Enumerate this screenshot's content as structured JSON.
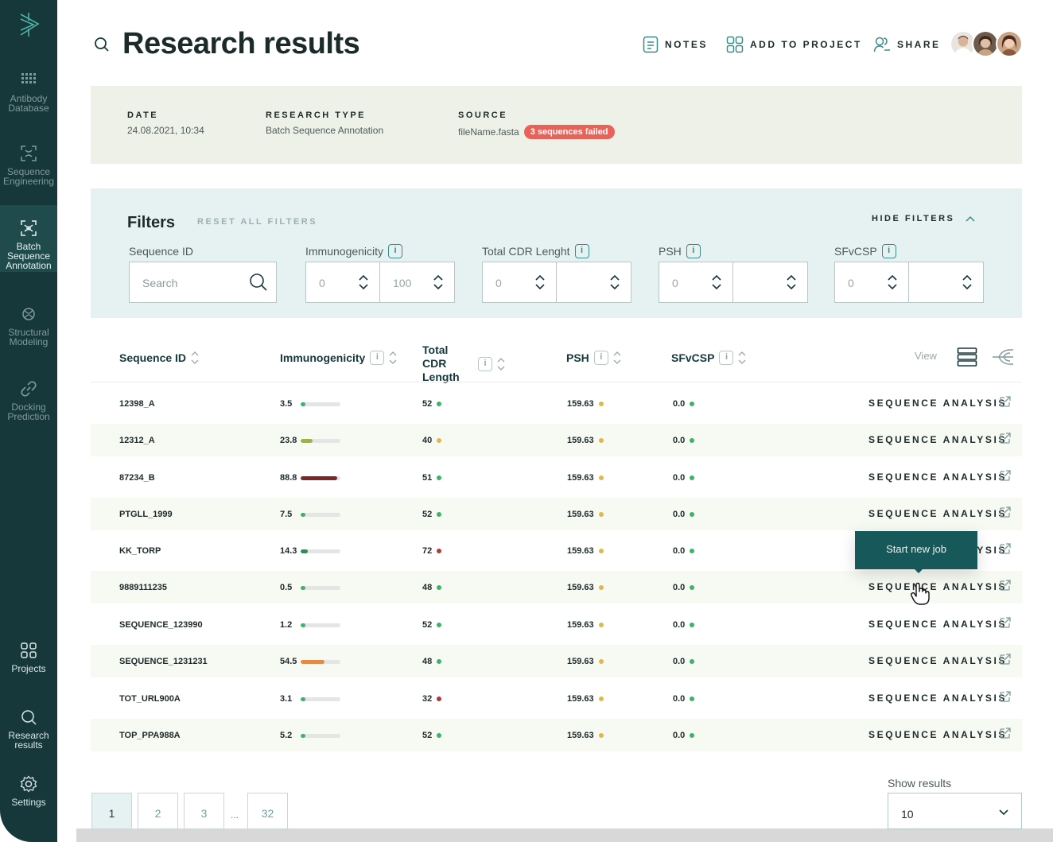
{
  "sidebar": {
    "items": [
      {
        "label": "Antibody\nDatabase",
        "icon": "grid-dots-icon"
      },
      {
        "label": "Sequence\nEngineering",
        "icon": "dna-frame-icon"
      },
      {
        "label": "Batch\nSequence\nAnnotation",
        "icon": "batch-dna-icon"
      },
      {
        "label": "Structural\nModeling",
        "icon": "molecule-icon"
      },
      {
        "label": "Docking\nPrediction",
        "icon": "link-icon"
      },
      {
        "label": "Projects",
        "icon": "projects-icon"
      },
      {
        "label": "Research\nresults",
        "icon": "search-icon"
      },
      {
        "label": "Settings",
        "icon": "gear-icon"
      }
    ]
  },
  "header": {
    "title": "Research results",
    "notes": "NOTES",
    "add_to_project": "ADD TO PROJECT",
    "share": "SHARE"
  },
  "info": {
    "date_label": "DATE",
    "date_value": "24.08.2021, 10:34",
    "type_label": "RESEARCH TYPE",
    "type_value": "Batch Sequence Annotation",
    "source_label": "SOURCE",
    "source_value": "fileName.fasta",
    "failed_badge": "3 sequences failed"
  },
  "filters": {
    "title": "Filters",
    "reset": "RESET ALL FILTERS",
    "hide": "HIDE FILTERS",
    "sequence_id_label": "Sequence ID",
    "search_placeholder": "Search",
    "immunogenicity_label": "Immunogenicity",
    "imm_min": "0",
    "imm_max": "100",
    "cdr_label": "Total CDR Lenght",
    "cdr_min": "0",
    "psh_label": "PSH",
    "psh_min": "0",
    "sfv_label": "SFvCSP",
    "sfv_min": "0"
  },
  "table": {
    "headers": {
      "sequence_id": "Sequence ID",
      "immunogenicity": "Immunogenicity",
      "cdr": "Total CDR Length",
      "psh": "PSH",
      "sfv": "SFvCSP",
      "view": "View"
    },
    "action_label": "SEQUENCE ANALYSIS",
    "rows": [
      {
        "id": "12398_A",
        "imm": "3.5",
        "imm_pct": 0.035,
        "imm_color": "#3bb36b",
        "cdr": "52",
        "cdr_color": "#3bb36b",
        "psh": "159.63",
        "psh_color": "#e0b84a",
        "sfv": "0.0",
        "sfv_color": "#3bb36b"
      },
      {
        "id": "12312_A",
        "imm": "23.8",
        "imm_pct": 0.3,
        "imm_color": "#9db04f",
        "cdr": "40",
        "cdr_color": "#e0b84a",
        "psh": "159.63",
        "psh_color": "#e0b84a",
        "sfv": "0.0",
        "sfv_color": "#3bb36b"
      },
      {
        "id": "87234_B",
        "imm": "88.8",
        "imm_pct": 0.92,
        "imm_color": "#7a2726",
        "cdr": "51",
        "cdr_color": "#3bb36b",
        "psh": "159.63",
        "psh_color": "#e0b84a",
        "sfv": "0.0",
        "sfv_color": "#3bb36b"
      },
      {
        "id": "PTGLL_1999",
        "imm": "7.5",
        "imm_pct": 0.075,
        "imm_color": "#3bb36b",
        "cdr": "52",
        "cdr_color": "#3bb36b",
        "psh": "159.63",
        "psh_color": "#e0b84a",
        "sfv": "0.0",
        "sfv_color": "#3bb36b"
      },
      {
        "id": "KK_TORP",
        "imm": "14.3",
        "imm_pct": 0.17,
        "imm_color": "#2f8d57",
        "cdr": "72",
        "cdr_color": "#b03a3a",
        "psh": "159.63",
        "psh_color": "#e0b84a",
        "sfv": "0.0",
        "sfv_color": "#3bb36b"
      },
      {
        "id": "9889111235",
        "imm": "0.5",
        "imm_pct": 0.03,
        "imm_color": "#3bb36b",
        "cdr": "48",
        "cdr_color": "#3bb36b",
        "psh": "159.63",
        "psh_color": "#e0b84a",
        "sfv": "0.0",
        "sfv_color": "#3bb36b"
      },
      {
        "id": "SEQUENCE_123990",
        "imm": "1.2",
        "imm_pct": 0.03,
        "imm_color": "#3bb36b",
        "cdr": "52",
        "cdr_color": "#3bb36b",
        "psh": "159.63",
        "psh_color": "#e0b84a",
        "sfv": "0.0",
        "sfv_color": "#3bb36b"
      },
      {
        "id": "SEQUENCE_1231231",
        "imm": "54.5",
        "imm_pct": 0.6,
        "imm_color": "#e38b4a",
        "cdr": "48",
        "cdr_color": "#3bb36b",
        "psh": "159.63",
        "psh_color": "#e0b84a",
        "sfv": "0.0",
        "sfv_color": "#3bb36b"
      },
      {
        "id": "TOT_URL900A",
        "imm": "3.1",
        "imm_pct": 0.035,
        "imm_color": "#3bb36b",
        "cdr": "32",
        "cdr_color": "#b03a3a",
        "psh": "159.63",
        "psh_color": "#e0b84a",
        "sfv": "0.0",
        "sfv_color": "#3bb36b"
      },
      {
        "id": "TOP_PPA988A",
        "imm": "5.2",
        "imm_pct": 0.05,
        "imm_color": "#3bb36b",
        "cdr": "52",
        "cdr_color": "#3bb36b",
        "psh": "159.63",
        "psh_color": "#e0b84a",
        "sfv": "0.0",
        "sfv_color": "#3bb36b"
      }
    ]
  },
  "tooltip": "Start new job",
  "pagination": {
    "pages": [
      "1",
      "2",
      "3",
      "32"
    ],
    "ellipsis": "...",
    "show_label": "Show results",
    "show_value": "10"
  },
  "colors": {
    "sidebar_bg": "#17383b",
    "accent": "#3a8b87",
    "danger": "#e8625a"
  }
}
